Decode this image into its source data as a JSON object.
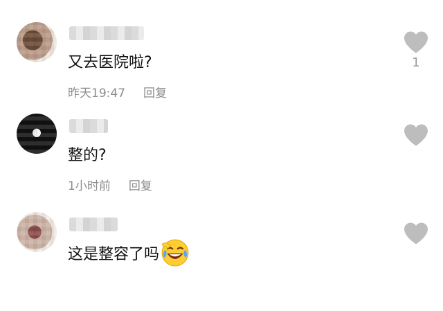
{
  "comments": [
    {
      "text": "又去医院啦?",
      "time": "昨天19:47",
      "reply_label": "回复",
      "like_count": "1",
      "icons": [
        "avatar",
        "heart-icon"
      ]
    },
    {
      "text": "整的?",
      "time": "1小时前",
      "reply_label": "回复",
      "icons": [
        "avatar",
        "heart-icon"
      ]
    },
    {
      "text": "这是整容了吗",
      "emoji": "laughing-crying-face",
      "icons": [
        "avatar",
        "heart-icon"
      ]
    }
  ],
  "colors": {
    "text": "#111111",
    "meta": "#8c8c8c",
    "heart": "#bdbdbd"
  }
}
